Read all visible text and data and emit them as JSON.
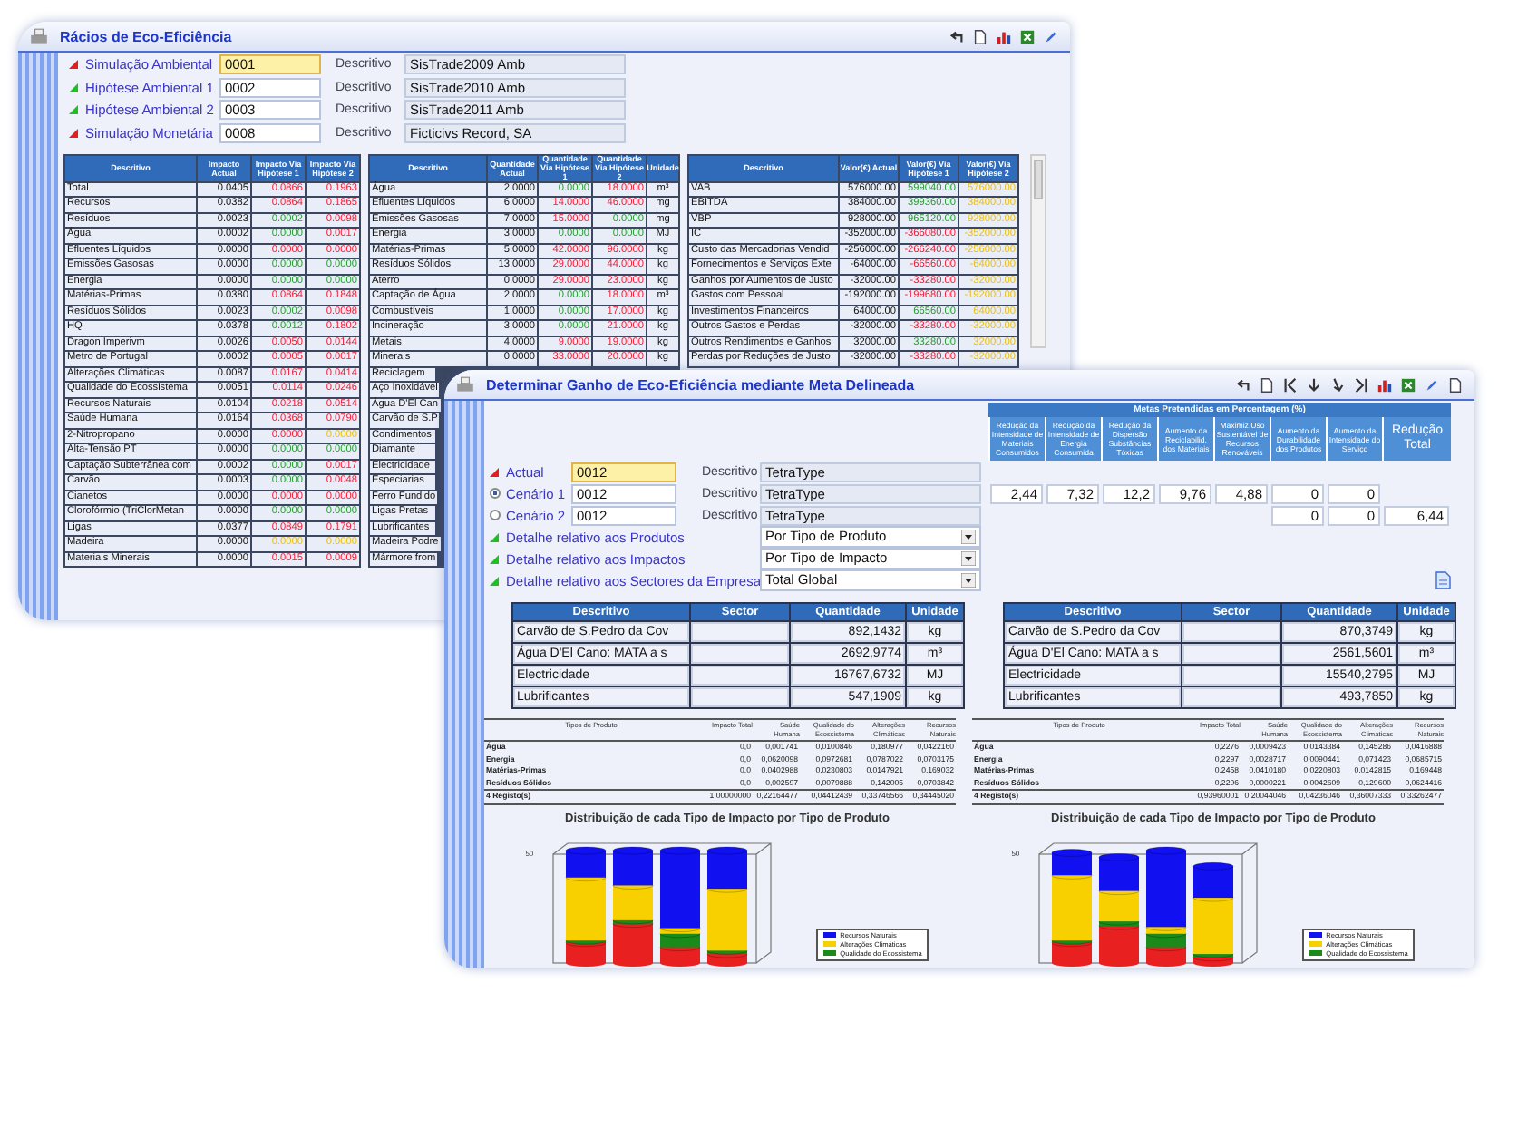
{
  "back_window": {
    "title": "Rácios de Eco-Eficiência",
    "fields": [
      {
        "label": "Simulação Ambiental",
        "value": "0001",
        "highlighted": true,
        "color": "#e02020",
        "desc_label": "Descritivo",
        "description": "SisTrade2009 Amb"
      },
      {
        "label": "Hipótese Ambiental 1",
        "value": "0002",
        "highlighted": false,
        "color": "#20c020",
        "desc_label": "Descritivo",
        "description": "SisTrade2010 Amb"
      },
      {
        "label": "Hipótese Ambiental 2",
        "value": "0003",
        "highlighted": false,
        "color": "#20c020",
        "desc_label": "Descritivo",
        "description": "SisTrade2011 Amb"
      },
      {
        "label": "Simulação Monetária",
        "value": "0008",
        "highlighted": false,
        "color": "#e02020",
        "desc_label": "Descritivo",
        "description": "Ficticivs Record, SA"
      }
    ],
    "impact_table": {
      "columns": [
        "Descritivo",
        "Impacto Actual",
        "Impacto Via Hipótese 1",
        "Impacto Via Hipótese 2"
      ],
      "rows": [
        {
          "label": "Total",
          "actual": "0.0405",
          "hyp1": {
            "value": "0.0866",
            "color": "#f0203a"
          },
          "hyp2": {
            "value": "0.1963",
            "color": "#f0203a"
          }
        },
        {
          "label": "Recursos",
          "actual": "0.0382",
          "hyp1": {
            "value": "0.0864",
            "color": "#f0203a"
          },
          "hyp2": {
            "value": "0.1865",
            "color": "#f0203a"
          }
        },
        {
          "label": "Resíduos",
          "actual": "0.0023",
          "hyp1": {
            "value": "0.0002",
            "color": "#2e9a3a"
          },
          "hyp2": {
            "value": "0.0098",
            "color": "#f0203a"
          }
        },
        {
          "label": "Água",
          "actual": "0.0002",
          "hyp1": {
            "value": "0.0000",
            "color": "#2e9a3a"
          },
          "hyp2": {
            "value": "0.0017",
            "color": "#f0203a"
          }
        },
        {
          "label": "Efluentes Líquidos",
          "actual": "0.0000",
          "hyp1": {
            "value": "0.0000",
            "color": "#f0203a"
          },
          "hyp2": {
            "value": "0.0000",
            "color": "#f0203a"
          }
        },
        {
          "label": "Emissões Gasosas",
          "actual": "0.0000",
          "hyp1": {
            "value": "0.0000",
            "color": "#2e9a3a"
          },
          "hyp2": {
            "value": "0.0000",
            "color": "#2e9a3a"
          }
        },
        {
          "label": "Energia",
          "actual": "0.0000",
          "hyp1": {
            "value": "0.0000",
            "color": "#2e9a3a"
          },
          "hyp2": {
            "value": "0.0000",
            "color": "#2e9a3a"
          }
        },
        {
          "label": "Matérias-Primas",
          "actual": "0.0380",
          "hyp1": {
            "value": "0.0864",
            "color": "#f0203a"
          },
          "hyp2": {
            "value": "0.1848",
            "color": "#f0203a"
          }
        },
        {
          "label": "Resíduos Sólidos",
          "actual": "0.0023",
          "hyp1": {
            "value": "0.0002",
            "color": "#2e9a3a"
          },
          "hyp2": {
            "value": "0.0098",
            "color": "#f0203a"
          }
        },
        {
          "label": "HQ",
          "actual": "0.0378",
          "hyp1": {
            "value": "0.0012",
            "color": "#2e9a3a"
          },
          "hyp2": {
            "value": "0.1802",
            "color": "#f0203a"
          }
        },
        {
          "label": "Dragon Imperivm",
          "actual": "0.0026",
          "hyp1": {
            "value": "0.0050",
            "color": "#f0203a"
          },
          "hyp2": {
            "value": "0.0144",
            "color": "#f0203a"
          }
        },
        {
          "label": "Metro de Portugal",
          "actual": "0.0002",
          "hyp1": {
            "value": "0.0005",
            "color": "#f0203a"
          },
          "hyp2": {
            "value": "0.0017",
            "color": "#f0203a"
          }
        },
        {
          "label": "Alterações Climáticas",
          "actual": "0.0087",
          "hyp1": {
            "value": "0.0167",
            "color": "#f0203a"
          },
          "hyp2": {
            "value": "0.0414",
            "color": "#f0203a"
          }
        },
        {
          "label": "Qualidade do Ecossistema",
          "actual": "0.0051",
          "hyp1": {
            "value": "0.0114",
            "color": "#f0203a"
          },
          "hyp2": {
            "value": "0.0246",
            "color": "#f0203a"
          }
        },
        {
          "label": "Recursos Naturais",
          "actual": "0.0104",
          "hyp1": {
            "value": "0.0218",
            "color": "#f0203a"
          },
          "hyp2": {
            "value": "0.0514",
            "color": "#f0203a"
          }
        },
        {
          "label": "Saúde Humana",
          "actual": "0.0164",
          "hyp1": {
            "value": "0.0368",
            "color": "#f0203a"
          },
          "hyp2": {
            "value": "0.0790",
            "color": "#f0203a"
          }
        },
        {
          "label": "2-Nitropropano",
          "actual": "0.0000",
          "hyp1": {
            "value": "0.0000",
            "color": "#f0203a"
          },
          "hyp2": {
            "value": "0.0000",
            "color": "#e8c020"
          }
        },
        {
          "label": "Alta-Tensão PT",
          "actual": "0.0000",
          "hyp1": {
            "value": "0.0000",
            "color": "#2e9a3a"
          },
          "hyp2": {
            "value": "0.0000",
            "color": "#2e9a3a"
          }
        },
        {
          "label": "Captação Subterrânea com",
          "actual": "0.0002",
          "hyp1": {
            "value": "0.0000",
            "color": "#2e9a3a"
          },
          "hyp2": {
            "value": "0.0017",
            "color": "#f0203a"
          }
        },
        {
          "label": "Carvão",
          "actual": "0.0003",
          "hyp1": {
            "value": "0.0000",
            "color": "#2e9a3a"
          },
          "hyp2": {
            "value": "0.0048",
            "color": "#f0203a"
          }
        },
        {
          "label": "Cianetos",
          "actual": "0.0000",
          "hyp1": {
            "value": "0.0000",
            "color": "#f0203a"
          },
          "hyp2": {
            "value": "0.0000",
            "color": "#f0203a"
          }
        },
        {
          "label": "Clorofórmio (TriClorMetan",
          "actual": "0.0000",
          "hyp1": {
            "value": "0.0000",
            "color": "#2e9a3a"
          },
          "hyp2": {
            "value": "0.0000",
            "color": "#2e9a3a"
          }
        },
        {
          "label": "Ligas",
          "actual": "0.0377",
          "hyp1": {
            "value": "0.0849",
            "color": "#f0203a"
          },
          "hyp2": {
            "value": "0.1791",
            "color": "#f0203a"
          }
        },
        {
          "label": "Madeira",
          "actual": "0.0000",
          "hyp1": {
            "value": "0.0000",
            "color": "#e8c020"
          },
          "hyp2": {
            "value": "0.0000",
            "color": "#e8c020"
          }
        },
        {
          "label": "Materiais Minerais",
          "actual": "0.0000",
          "hyp1": {
            "value": "0.0015",
            "color": "#f0203a"
          },
          "hyp2": {
            "value": "0.0009",
            "color": "#f0203a"
          }
        }
      ]
    },
    "quantity_table": {
      "columns": [
        "Descritivo",
        "Quantidade Actual",
        "Quantidade Via Hipótese 1",
        "Quantidade Via Hipótese 2",
        "Unidade"
      ],
      "rows": [
        {
          "kind": "full",
          "label": "Água",
          "actual": "2.0000",
          "hyp1": {
            "value": "0.0000",
            "color": "#2e9a3a"
          },
          "hyp2": {
            "value": "18.0000",
            "color": "#f0203a"
          },
          "unit": "m³"
        },
        {
          "kind": "full",
          "label": "Efluentes Líquidos",
          "actual": "6.0000",
          "hyp1": {
            "value": "14.0000",
            "color": "#f0203a"
          },
          "hyp2": {
            "value": "46.0000",
            "color": "#f0203a"
          },
          "unit": "mg"
        },
        {
          "kind": "full",
          "label": "Emissões Gasosas",
          "actual": "7.0000",
          "hyp1": {
            "value": "15.0000",
            "color": "#f0203a"
          },
          "hyp2": {
            "value": "0.0000",
            "color": "#2e9a3a"
          },
          "unit": "mg"
        },
        {
          "kind": "full",
          "label": "Energia",
          "actual": "3.0000",
          "hyp1": {
            "value": "0.0000",
            "color": "#2e9a3a"
          },
          "hyp2": {
            "value": "0.0000",
            "color": "#2e9a3a"
          },
          "unit": "MJ"
        },
        {
          "kind": "full",
          "label": "Matérias-Primas",
          "actual": "5.0000",
          "hyp1": {
            "value": "42.0000",
            "color": "#f0203a"
          },
          "hyp2": {
            "value": "96.0000",
            "color": "#f0203a"
          },
          "unit": "kg"
        },
        {
          "kind": "full",
          "label": "Resíduos Sólidos",
          "actual": "13.0000",
          "hyp1": {
            "value": "29.0000",
            "color": "#f0203a"
          },
          "hyp2": {
            "value": "44.0000",
            "color": "#f0203a"
          },
          "unit": "kg"
        },
        {
          "kind": "full",
          "label": "Aterro",
          "actual": "0.0000",
          "hyp1": {
            "value": "29.0000",
            "color": "#f0203a"
          },
          "hyp2": {
            "value": "23.0000",
            "color": "#f0203a"
          },
          "unit": "kg"
        },
        {
          "kind": "full",
          "label": "Captação de Água",
          "actual": "2.0000",
          "hyp1": {
            "value": "0.0000",
            "color": "#2e9a3a"
          },
          "hyp2": {
            "value": "18.0000",
            "color": "#f0203a"
          },
          "unit": "m³"
        },
        {
          "kind": "full",
          "label": "Combustíveis",
          "actual": "1.0000",
          "hyp1": {
            "value": "0.0000",
            "color": "#2e9a3a"
          },
          "hyp2": {
            "value": "17.0000",
            "color": "#f0203a"
          },
          "unit": "kg"
        },
        {
          "kind": "full",
          "label": "Incineração",
          "actual": "3.0000",
          "hyp1": {
            "value": "0.0000",
            "color": "#2e9a3a"
          },
          "hyp2": {
            "value": "21.0000",
            "color": "#f0203a"
          },
          "unit": "kg"
        },
        {
          "kind": "full",
          "label": "Metais",
          "actual": "4.0000",
          "hyp1": {
            "value": "9.0000",
            "color": "#f0203a"
          },
          "hyp2": {
            "value": "19.0000",
            "color": "#f0203a"
          },
          "unit": "kg"
        },
        {
          "kind": "full",
          "label": "Minerais",
          "actual": "0.0000",
          "hyp1": {
            "value": "33.0000",
            "color": "#f0203a"
          },
          "hyp2": {
            "value": "20.0000",
            "color": "#f0203a"
          },
          "unit": "kg"
        },
        {
          "kind": "partial",
          "label": "Reciclagem"
        },
        {
          "kind": "partial",
          "label": "Aço Inoxidável"
        },
        {
          "kind": "partial",
          "label": "Água D'El Can"
        },
        {
          "kind": "partial",
          "label": "Carvão de S.P"
        },
        {
          "kind": "partial",
          "label": "Condimentos"
        },
        {
          "kind": "partial",
          "label": "Diamante"
        },
        {
          "kind": "partial",
          "label": "Electricidade"
        },
        {
          "kind": "partial",
          "label": "Especiarias"
        },
        {
          "kind": "partial",
          "label": "Ferro Fundido"
        },
        {
          "kind": "partial",
          "label": "Ligas Pretas"
        },
        {
          "kind": "partial",
          "label": "Lubrificantes"
        },
        {
          "kind": "partial",
          "label": "Madeira Podre"
        },
        {
          "kind": "partial",
          "label": "Mármore from"
        }
      ]
    },
    "value_table": {
      "columns": [
        "Descritivo",
        "Valor(€) Actual",
        "Valor(€) Via Hipótese 1",
        "Valor(€) Via Hipótese 2"
      ],
      "rows": [
        {
          "label": "VAB",
          "actual": "576000.00",
          "hyp1": {
            "value": "599040.00",
            "color": "#2e9a3a"
          },
          "hyp2": {
            "value": "576000.00",
            "color": "#e8c020"
          }
        },
        {
          "label": "EBITDA",
          "actual": "384000.00",
          "hyp1": {
            "value": "399360.00",
            "color": "#2e9a3a"
          },
          "hyp2": {
            "value": "384000.00",
            "color": "#e8c020"
          }
        },
        {
          "label": "VBP",
          "actual": "928000.00",
          "hyp1": {
            "value": "965120.00",
            "color": "#2e9a3a"
          },
          "hyp2": {
            "value": "928000.00",
            "color": "#e8c020"
          }
        },
        {
          "label": "IC",
          "actual": "-352000.00",
          "hyp1": {
            "value": "-366080.00",
            "color": "#f0203a"
          },
          "hyp2": {
            "value": "-352000.00",
            "color": "#e8c020"
          }
        },
        {
          "label": "Custo das Mercadorias Vendid",
          "actual": "-256000.00",
          "hyp1": {
            "value": "-266240.00",
            "color": "#f0203a"
          },
          "hyp2": {
            "value": "-256000.00",
            "color": "#e8c020"
          }
        },
        {
          "label": "Fornecimentos e Serviços Exte",
          "actual": "-64000.00",
          "hyp1": {
            "value": "-66560.00",
            "color": "#f0203a"
          },
          "hyp2": {
            "value": "-64000.00",
            "color": "#e8c020"
          }
        },
        {
          "label": "Ganhos por Aumentos de Justo",
          "actual": "-32000.00",
          "hyp1": {
            "value": "-33280.00",
            "color": "#f0203a"
          },
          "hyp2": {
            "value": "-32000.00",
            "color": "#e8c020"
          }
        },
        {
          "label": "Gastos com Pessoal",
          "actual": "-192000.00",
          "hyp1": {
            "value": "-199680.00",
            "color": "#f0203a"
          },
          "hyp2": {
            "value": "-192000.00",
            "color": "#e8c020"
          }
        },
        {
          "label": "Investimentos Financeiros",
          "actual": "64000.00",
          "hyp1": {
            "value": "66560.00",
            "color": "#2e9a3a"
          },
          "hyp2": {
            "value": "64000.00",
            "color": "#e8c020"
          }
        },
        {
          "label": "Outros Gastos e Perdas",
          "actual": "-32000.00",
          "hyp1": {
            "value": "-33280.00",
            "color": "#f0203a"
          },
          "hyp2": {
            "value": "-32000.00",
            "color": "#e8c020"
          }
        },
        {
          "label": "Outros Rendimentos e Ganhos",
          "actual": "32000.00",
          "hyp1": {
            "value": "33280.00",
            "color": "#2e9a3a"
          },
          "hyp2": {
            "value": "32000.00",
            "color": "#e8c020"
          }
        },
        {
          "label": "Perdas por Reduções de Justo",
          "actual": "-32000.00",
          "hyp1": {
            "value": "-33280.00",
            "color": "#f0203a"
          },
          "hyp2": {
            "value": "-32000.00",
            "color": "#e8c020"
          }
        }
      ]
    }
  },
  "front_window": {
    "title": "Determinar Ganho de Eco-Eficiência mediante Meta Delineada",
    "targets_header": "Metas Pretendidas em Percentagem (%)",
    "target_columns": [
      {
        "label": "Redução da Intensidade de Materiais Consumidos",
        "scenario_1": "2,44"
      },
      {
        "label": "Redução da Intensidade de Energia Consumida",
        "scenario_1": "7,32"
      },
      {
        "label": "Redução da Dispersão Substâncias Tóxicas",
        "scenario_1": "12,2"
      },
      {
        "label": "Aumento da Reciclabilid. dos Materiais",
        "scenario_1": "9,76"
      },
      {
        "label": "Maximiz.Uso Sustentável de Recursos Renováveis",
        "scenario_1": "4,88"
      },
      {
        "label": "Aumento da Durabilidade dos Produtos",
        "scenario_1": "0",
        "scenario_2": "0"
      },
      {
        "label": "Aumento da Intensidade do Serviço",
        "scenario_1": "0",
        "scenario_2": "0"
      },
      {
        "label": "Redução Total",
        "scenario_2": "6,44"
      }
    ],
    "scenarios": [
      {
        "kind": "marker",
        "label": "Actual",
        "value": "0012",
        "highlighted": true,
        "color": "#e02020",
        "desc_label": "Descritivo",
        "description": "TetraType"
      },
      {
        "kind": "radio",
        "label": "Cenário 1",
        "value": "0012",
        "highlighted": false,
        "selected": true,
        "desc_label": "Descritivo",
        "description": "TetraType"
      },
      {
        "kind": "radio",
        "label": "Cenário 2",
        "value": "0012",
        "highlighted": false,
        "selected": false,
        "desc_label": "Descritivo",
        "description": "TetraType"
      }
    ],
    "details": [
      {
        "label": "Detalhe relativo aos Produtos",
        "value": "Por Tipo de Produto",
        "color": "#20c020"
      },
      {
        "label": "Detalhe relativo aos Impactos",
        "value": "Por Tipo de Impacto",
        "color": "#20c020"
      },
      {
        "label": "Detalhe relativo aos Sectores da Empresa",
        "value": "Total Global",
        "color": "#20c020"
      }
    ],
    "quantity_tables": [
      {
        "columns": [
          "Descritivo",
          "Sector",
          "Quantidade",
          "Unidade"
        ],
        "rows": [
          [
            "Carvão de S.Pedro da Cov",
            "",
            "892,1432",
            "kg"
          ],
          [
            "Água D'El Cano: MATA a s",
            "",
            "2692,9774",
            "m³"
          ],
          [
            "Electricidade",
            "",
            "16767,6732",
            "MJ"
          ],
          [
            "Lubrificantes",
            "",
            "547,1909",
            "kg"
          ]
        ]
      },
      {
        "columns": [
          "Descritivo",
          "Sector",
          "Quantidade",
          "Unidade"
        ],
        "rows": [
          [
            "Carvão de S.Pedro da Cov",
            "",
            "870,3749",
            "kg"
          ],
          [
            "Água D'El Cano: MATA a s",
            "",
            "2561,5601",
            "m³"
          ],
          [
            "Electricidade",
            "",
            "15540,2795",
            "MJ"
          ],
          [
            "Lubrificantes",
            "",
            "493,7850",
            "kg"
          ]
        ]
      }
    ],
    "impact_summaries": [
      {
        "columns": [
          "Tipos de Produto",
          "Impacto Total",
          "Saúde Humana",
          "Qualidade do Ecossistema",
          "Alterações Climáticas",
          "Recursos Naturais"
        ],
        "rows": [
          [
            "Água",
            "0,0",
            "0,001741",
            "0,0100846",
            "0,180977",
            "0,0422160"
          ],
          [
            "Energia",
            "0,0",
            "0,0620098",
            "0,0972681",
            "0,0787022",
            "0,0703175"
          ],
          [
            "Matérias-Primas",
            "0,0",
            "0,0402988",
            "0,0230803",
            "0,0147921",
            "0,169032"
          ],
          [
            "Resíduos Sólidos",
            "0,0",
            "0,002597",
            "0,0079888",
            "0,142005",
            "0,0703842"
          ]
        ],
        "footer": [
          "4 Registo(s)",
          "1,00000000",
          "0,22164477",
          "0,04412439",
          "0,33746566",
          "0,34445020"
        ]
      },
      {
        "columns": [
          "Tipos de Produto",
          "Impacto Total",
          "Saúde Humana",
          "Qualidade do Ecossistema",
          "Alterações Climáticas",
          "Recursos Naturais"
        ],
        "rows": [
          [
            "Água",
            "0,2276",
            "0,0009423",
            "0,0143384",
            "0,145286",
            "0,0416888"
          ],
          [
            "Energia",
            "0,2297",
            "0,0028717",
            "0,0090441",
            "0,071423",
            "0,0685715"
          ],
          [
            "Matérias-Primas",
            "0,2458",
            "0,0410180",
            "0,0220803",
            "0,0142815",
            "0,169448"
          ],
          [
            "Resíduos Sólidos",
            "0,2296",
            "0,0000221",
            "0,0042609",
            "0,129600",
            "0,0624416"
          ]
        ],
        "footer": [
          "4 Registo(s)",
          "0,93960001",
          "0,20044046",
          "0,04236046",
          "0,36007333",
          "0,33262477"
        ]
      }
    ],
    "charts": [
      {
        "title": "Distribuição de cada Tipo de Impacto por Tipo de Produto",
        "axis_label": "50",
        "legend": [
          {
            "label": "Recursos Naturais",
            "color": "#1010f0"
          },
          {
            "label": "Alterações Climáticas",
            "color": "#f8d000"
          },
          {
            "label": "Qualidade do Ecossistema",
            "color": "#1a8a1a"
          }
        ]
      },
      {
        "title": "Distribuição de cada Tipo de Impacto por Tipo de Produto",
        "axis_label": "50",
        "legend": [
          {
            "label": "Recursos Naturais",
            "color": "#1010f0"
          },
          {
            "label": "Alterações Climáticas",
            "color": "#f8d000"
          },
          {
            "label": "Qualidade do Ecossistema",
            "color": "#1a8a1a"
          }
        ]
      }
    ]
  }
}
